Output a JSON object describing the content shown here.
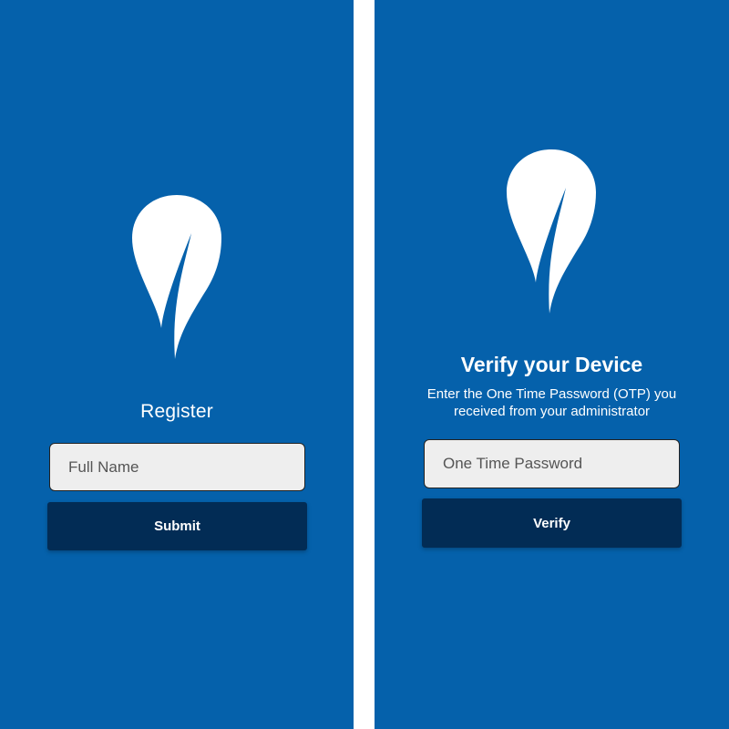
{
  "colors": {
    "panel_bg": "#0561ab",
    "divider": "#ffffff",
    "button_bg": "#022c55",
    "field_bg": "#eeeeee",
    "text_light": "#ffffff"
  },
  "register_screen": {
    "logo_icon": "leaf-drop-icon",
    "title": "Register",
    "name_field": {
      "placeholder": "Full Name",
      "value": ""
    },
    "submit_label": "Submit"
  },
  "verify_screen": {
    "logo_icon": "leaf-drop-icon",
    "title": "Verify your Device",
    "description_line1": "Enter the One Time Password (OTP) you",
    "description_line2": "received from your administrator",
    "otp_field": {
      "placeholder": "One Time Password",
      "value": ""
    },
    "verify_label": "Verify"
  }
}
